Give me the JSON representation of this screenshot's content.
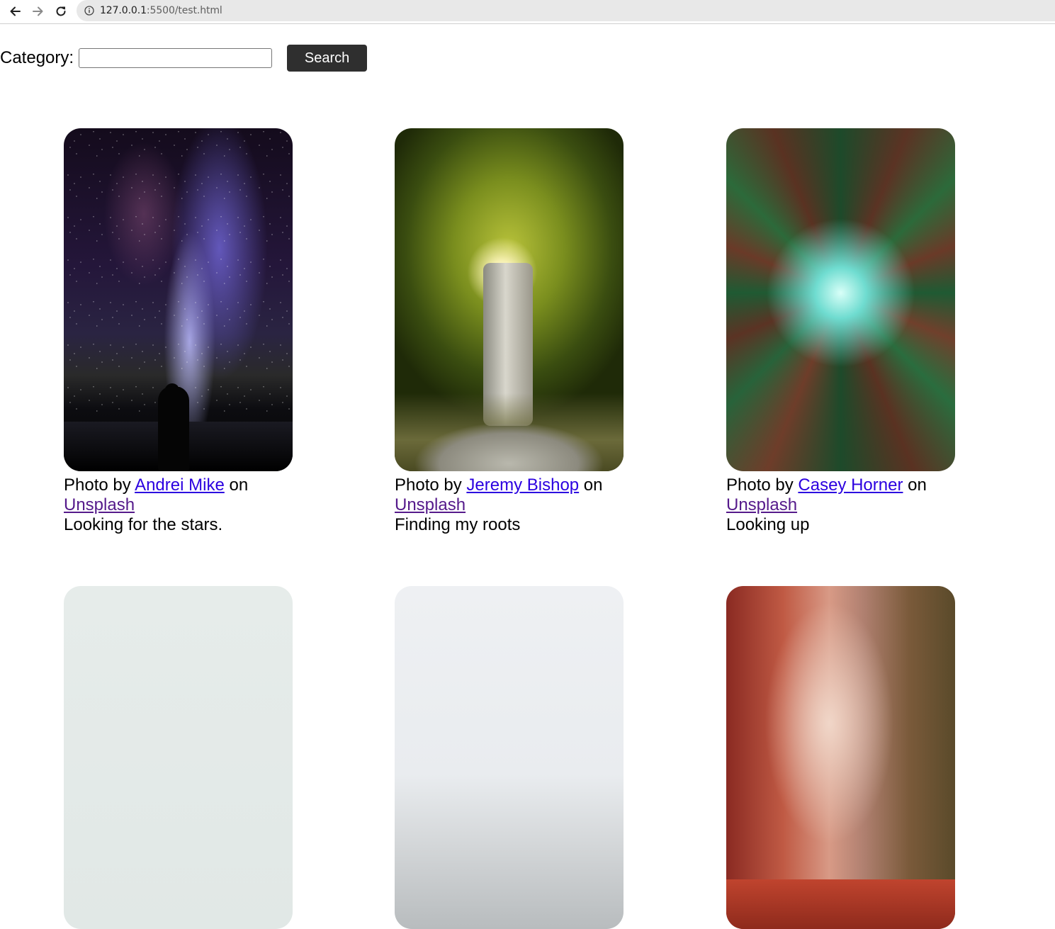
{
  "browser": {
    "url_host": "127.0.0.1",
    "url_path": ":5500/test.html"
  },
  "form": {
    "label": "Category:",
    "input_value": "",
    "button_label": "Search"
  },
  "cards": [
    {
      "prefix": "Photo by ",
      "author": "Andrei Mike",
      "middle": " on ",
      "site": "Unsplash",
      "caption": "Looking for the stars."
    },
    {
      "prefix": "Photo by ",
      "author": "Jeremy Bishop",
      "middle": " on ",
      "site": "Unsplash",
      "caption": "Finding my roots"
    },
    {
      "prefix": "Photo by ",
      "author": "Casey Horner",
      "middle": " on ",
      "site": "Unsplash",
      "caption": "Looking up"
    },
    {
      "prefix": "",
      "author": "",
      "middle": "",
      "site": "",
      "caption": ""
    },
    {
      "prefix": "",
      "author": "",
      "middle": "",
      "site": "",
      "caption": ""
    },
    {
      "prefix": "",
      "author": "",
      "middle": "",
      "site": "",
      "caption": ""
    }
  ],
  "colors": {
    "link": "#2b00e0",
    "visited_link": "#551a8b",
    "button_bg": "#2f2f2f"
  }
}
